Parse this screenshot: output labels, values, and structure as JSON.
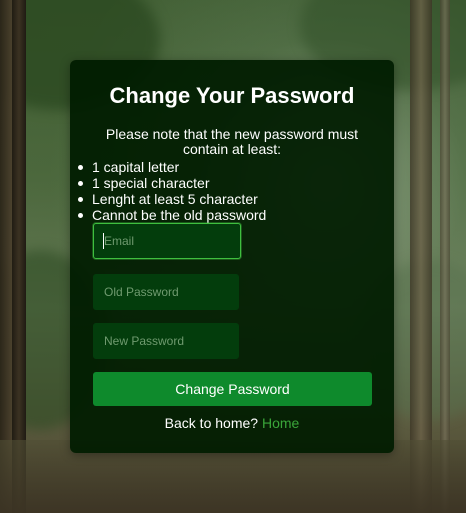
{
  "form": {
    "title": "Change Your Password",
    "note": "Please note that the new password must contain at least:",
    "rules": [
      "1 capital letter",
      "1 special character",
      "Lenght at least 5 character",
      "Cannot be the old password"
    ],
    "email_placeholder": "Email",
    "old_password_placeholder": "Old Password",
    "new_password_placeholder": "New Password",
    "submit_label": "Change Password",
    "footer_text": "Back to home?",
    "footer_link": "Home"
  },
  "colors": {
    "card_background": "#001c00",
    "input_background": "#033d0c",
    "input_focus_border": "#3fbf3f",
    "button": "#0e8a2c",
    "link": "#3aa63a"
  }
}
